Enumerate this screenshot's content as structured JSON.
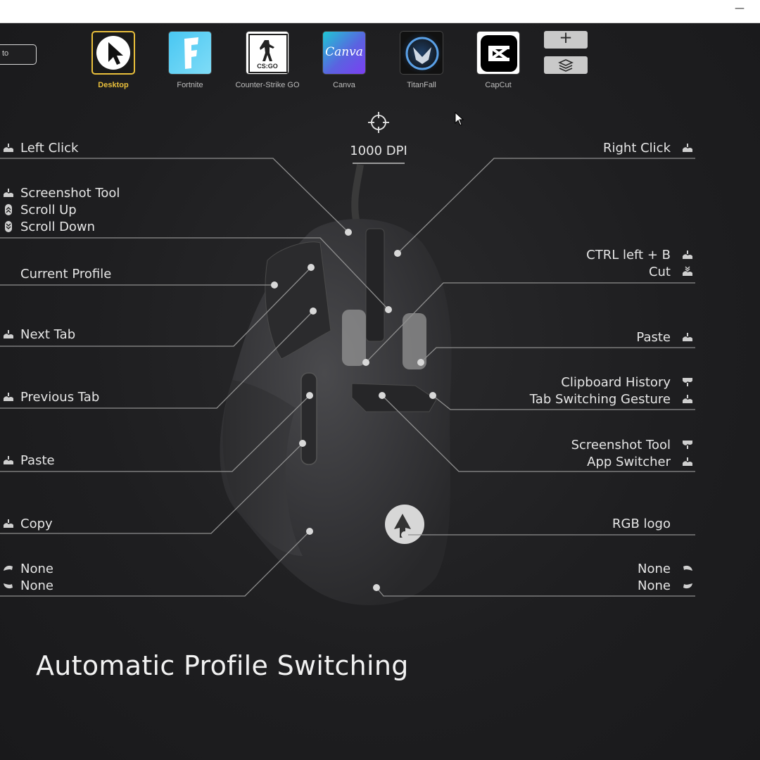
{
  "window": {
    "minimize_glyph": "—"
  },
  "search": {
    "value": "to"
  },
  "profiles": [
    {
      "label": "Desktop",
      "icon": "cursor-arrow-icon",
      "active": true
    },
    {
      "label": "Fortnite",
      "icon": "fortnite-f-icon"
    },
    {
      "label": "Counter-Strike GO",
      "icon": "csgo-icon",
      "tile_text": "CS:GO"
    },
    {
      "label": "Canva",
      "icon": "canva-icon",
      "tile_text": "Canva"
    },
    {
      "label": "TitanFall",
      "icon": "titanfall-icon"
    },
    {
      "label": "CapCut",
      "icon": "capcut-icon"
    }
  ],
  "actions": {
    "add_glyph": "+",
    "layers_icon": "layers-icon"
  },
  "dpi": {
    "value": "1000 DPI",
    "icon": "crosshair-icon"
  },
  "left_bindings": [
    {
      "label": "Left Click",
      "icon": "mouse-click-icon"
    },
    {
      "label": "Screenshot Tool",
      "icon": "mouse-click-icon"
    },
    {
      "label": "Scroll Up",
      "icon": "scroll-up-icon"
    },
    {
      "label": "Scroll Down",
      "icon": "scroll-down-icon"
    },
    {
      "label": "Current Profile",
      "icon": ""
    },
    {
      "label": "Next Tab",
      "icon": "mouse-click-icon"
    },
    {
      "label": "Previous Tab",
      "icon": "mouse-click-icon"
    },
    {
      "label": "Paste",
      "icon": "mouse-click-icon"
    },
    {
      "label": "Copy",
      "icon": "mouse-click-icon"
    },
    {
      "label": "None",
      "icon": "tilt-up-icon"
    },
    {
      "label": "None",
      "icon": "tilt-down-icon"
    }
  ],
  "right_bindings": [
    {
      "label": "Right Click",
      "icon": "mouse-click-icon"
    },
    {
      "label": "CTRL left + B",
      "icon": "mouse-click-icon"
    },
    {
      "label": "Cut",
      "icon": "double-click-icon"
    },
    {
      "label": "Paste",
      "icon": "mouse-click-icon"
    },
    {
      "label": "Clipboard History",
      "icon": "mouse-release-icon"
    },
    {
      "label": "Tab Switching Gesture",
      "icon": "mouse-click-icon"
    },
    {
      "label": "Screenshot Tool",
      "icon": "mouse-release-icon"
    },
    {
      "label": "App Switcher",
      "icon": "mouse-click-icon"
    },
    {
      "label": "RGB logo",
      "icon": ""
    },
    {
      "label": "None",
      "icon": "tilt-up-icon"
    },
    {
      "label": "None",
      "icon": "tilt-down-icon"
    }
  ],
  "headline": "Automatic Profile Switching"
}
